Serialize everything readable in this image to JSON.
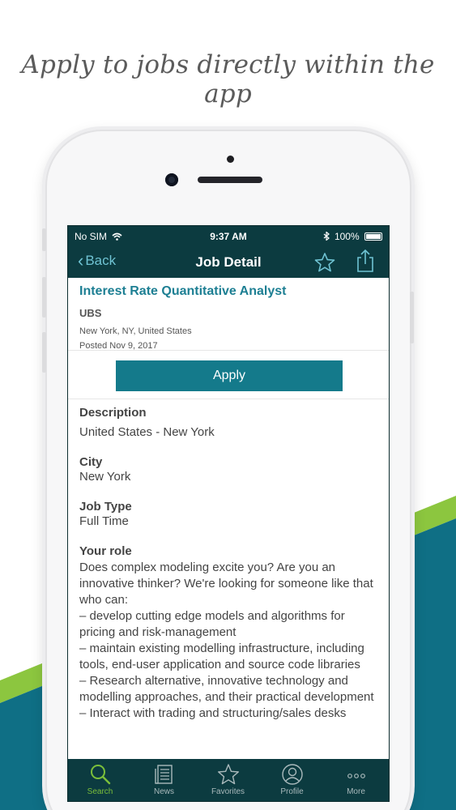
{
  "headline": "Apply to jobs directly within the app",
  "colors": {
    "nav": "#0c3b40",
    "accent": "#1d7f93",
    "apply": "#147a8b",
    "stripe_green": "#8cc63f",
    "stripe_teal": "#0f6f85"
  },
  "status_bar": {
    "carrier": "No SIM",
    "time": "9:37 AM",
    "battery": "100%"
  },
  "nav": {
    "back_label": "Back",
    "title": "Job Detail",
    "favorite_icon": "star-icon",
    "share_icon": "share-icon"
  },
  "job": {
    "title": "Interest Rate Quantitative Analyst",
    "company": "UBS",
    "location": "New York, NY, United States",
    "posted": "Posted Nov 9, 2017"
  },
  "apply_label": "Apply",
  "sections": {
    "description_label": "Description",
    "description_value": "United States - New York",
    "city_label": "City",
    "city_value": "New York",
    "job_type_label": "Job Type",
    "job_type_value": "Full Time",
    "role_label": "Your role",
    "role_text": "Does complex modeling excite you? Are you an innovative thinker? We're looking for someone like that who can:\n– develop cutting edge models and algorithms for pricing and risk-management\n– maintain existing modelling infrastructure, including tools, end-user application and source code libraries\n– Research alternative, innovative technology and modelling approaches, and their practical development\n– Interact with trading and structuring/sales desks"
  },
  "tabs": [
    {
      "label": "Search",
      "icon": "search-icon",
      "active": true
    },
    {
      "label": "News",
      "icon": "news-icon",
      "active": false
    },
    {
      "label": "Favorites",
      "icon": "star-icon",
      "active": false
    },
    {
      "label": "Profile",
      "icon": "profile-icon",
      "active": false
    },
    {
      "label": "More",
      "icon": "more-icon",
      "active": false
    }
  ]
}
